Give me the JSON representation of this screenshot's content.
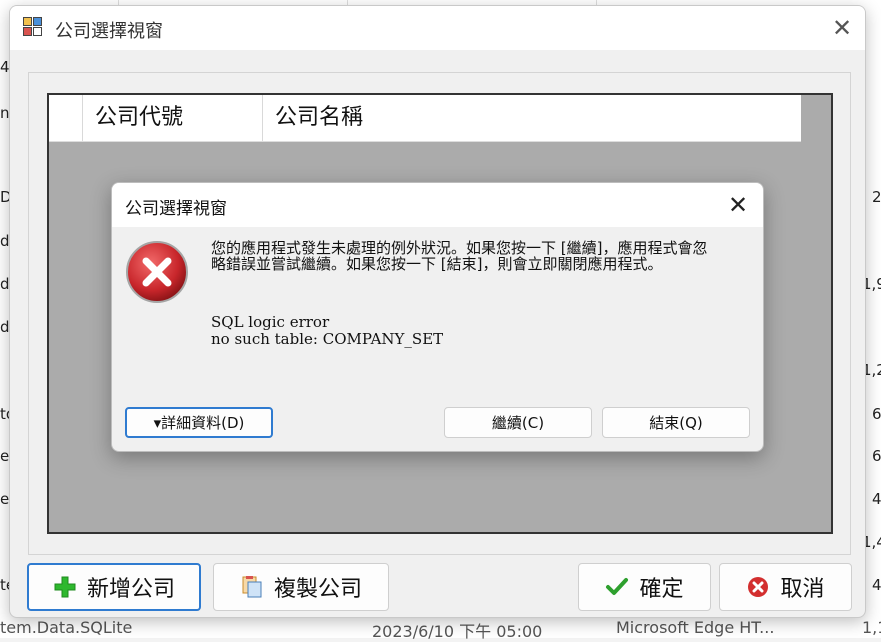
{
  "background": {
    "left_fragments": [
      "4",
      "n",
      "Da",
      "dl",
      "d.",
      "d",
      "to",
      "e",
      "e",
      "ter",
      "tem.Data.SQLite"
    ],
    "right_fragments": [
      "2",
      "1,9",
      "1,2",
      "6",
      "6",
      "4",
      "1,4",
      "4",
      "1,1"
    ],
    "bottom": {
      "date": "2023/6/10 下午 05:00",
      "type": "Microsoft Edge HT..."
    }
  },
  "main_dialog": {
    "title": "公司選擇視窗",
    "close_glyph": "✕",
    "grid": {
      "columns": [
        "公司代號",
        "公司名稱"
      ]
    },
    "buttons": {
      "add_company": "新增公司",
      "copy_company": "複製公司",
      "confirm": "確定",
      "cancel": "取消"
    }
  },
  "error_dialog": {
    "title": "公司選擇視窗",
    "close_glyph": "✕",
    "message": "您的應用程式發生未處理的例外狀況。如果您按一下 [繼續]，應用程式會忽略錯誤並嘗試繼續。如果您按一下 [結束]，則會立即關閉應用程式。",
    "error_line1": "SQL logic error",
    "error_line2": "no such table: COMPANY_SET",
    "buttons": {
      "details": "▾詳細資料(D)",
      "continue": "繼續(C)",
      "quit": "結束(Q)"
    }
  },
  "colors": {
    "accent_border": "#2f7bd0",
    "error_red": "#c8262b",
    "add_green": "#2eb82e",
    "check_green": "#2ea02e",
    "cancel_red": "#d32f2f"
  },
  "icons": {
    "app": "app-icon",
    "error": "error-x-icon",
    "add": "plus-icon",
    "copy": "copy-icon",
    "confirm": "checkmark-icon",
    "cancel": "cancel-icon"
  }
}
